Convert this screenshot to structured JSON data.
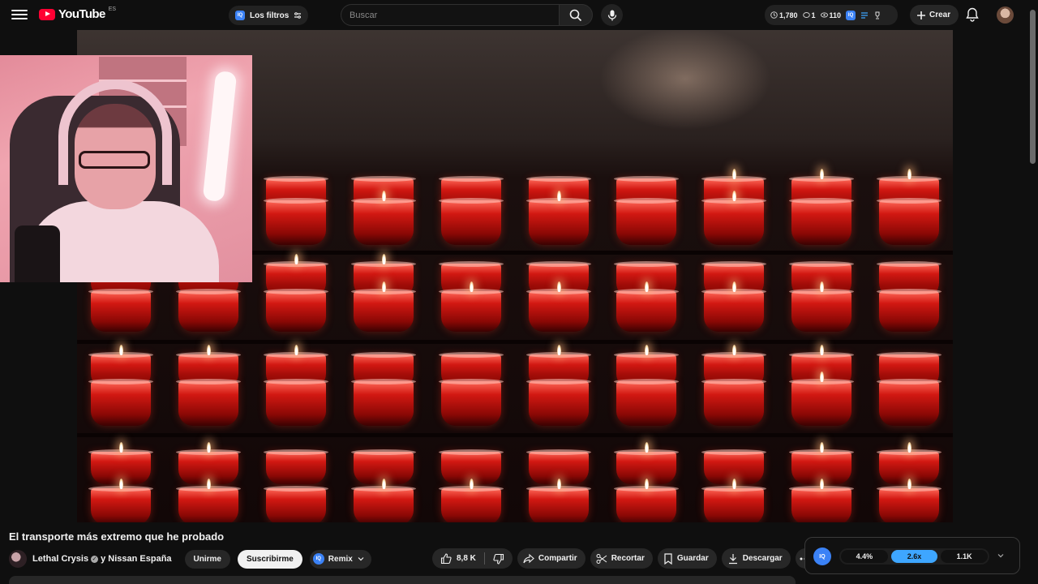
{
  "header": {
    "logo_text": "YouTube",
    "logo_country": "ES",
    "filters_label": "Los filtros",
    "iq_label": "IQ",
    "search_placeholder": "Buscar",
    "stats": {
      "views": "1,780",
      "comments": "1",
      "likes": "110"
    },
    "create_label": "Crear"
  },
  "video": {
    "title": "El transporte más extremo que he probado"
  },
  "channel": {
    "name": "Lethal Crysis",
    "collab": "y Nissan España",
    "join_label": "Unirme",
    "subscribe_label": "Suscribirme",
    "remix_label": "Remix"
  },
  "actions": {
    "like_count": "8,8 K",
    "share_label": "Compartir",
    "clip_label": "Recortar",
    "save_label": "Guardar",
    "download_label": "Descargar"
  },
  "iq_panel": {
    "badge": "IQ",
    "segments": [
      "4.4%",
      "2.6x",
      "1.1K"
    ],
    "active_index": 1
  },
  "colors": {
    "accent_red": "#ff0033",
    "iq_blue": "#3b82f6",
    "active_segment": "#3ea6ff",
    "background": "#0f0f0f"
  }
}
